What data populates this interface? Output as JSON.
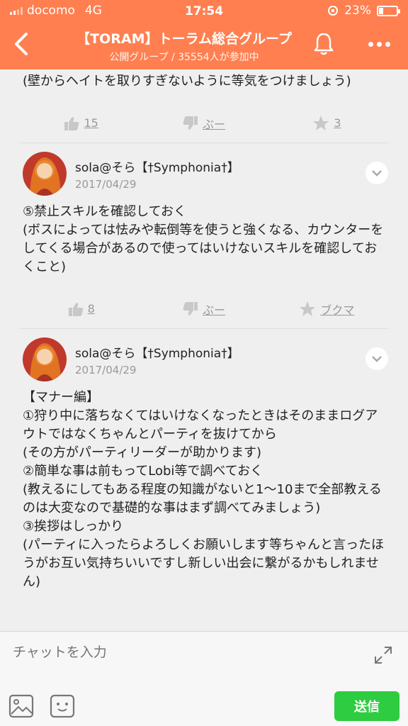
{
  "status": {
    "carrier": "docomo",
    "network": "4G",
    "time": "17:54",
    "battery": "23%",
    "battery_level": 0.23
  },
  "header": {
    "title": "【TORAM】トーラム総合グループ",
    "subtitle": "公開グループ / 35554人が参加中"
  },
  "thread": {
    "prev_tail": "(壁からヘイトを取りすぎないように等気をつけましょう)",
    "prev_actions": {
      "like": "15",
      "dislike": "ぶー",
      "fav": "3"
    },
    "posts": [
      {
        "author": "sola@そら【†Symphonia†】",
        "date": "2017/04/29",
        "body": "⑤禁止スキルを確認しておく\n(ボスによっては怯みや転倒等を使うと強くなる、カウンターをしてくる場合があるので使ってはいけないスキルを確認しておくこと)",
        "actions": {
          "like": "8",
          "dislike": "ぶー",
          "fav": "ブクマ"
        }
      },
      {
        "author": "sola@そら【†Symphonia†】",
        "date": "2017/04/29",
        "body": "【マナー編】\n①狩り中に落ちなくてはいけなくなったときはそのままログアウトではなくちゃんとパーティを抜けてから\n(その方がパーティリーダーが助かります)\n②簡単な事は前もってLobi等で調べておく\n(教えるにしてもある程度の知識がないと1〜10まで全部教えるのは大変なので基礎的な事はまず調べてみましょう)\n③挨拶はしっかり\n(パーティに入ったらよろしくお願いします等ちゃんと言ったほうがお互い気持ちいいですし新しい出会に繋がるかもしれません)"
      }
    ]
  },
  "chat": {
    "placeholder": "チャットを入力",
    "send_label": "送信"
  },
  "colors": {
    "header": "#ff7f50",
    "send": "#2ecc40"
  }
}
